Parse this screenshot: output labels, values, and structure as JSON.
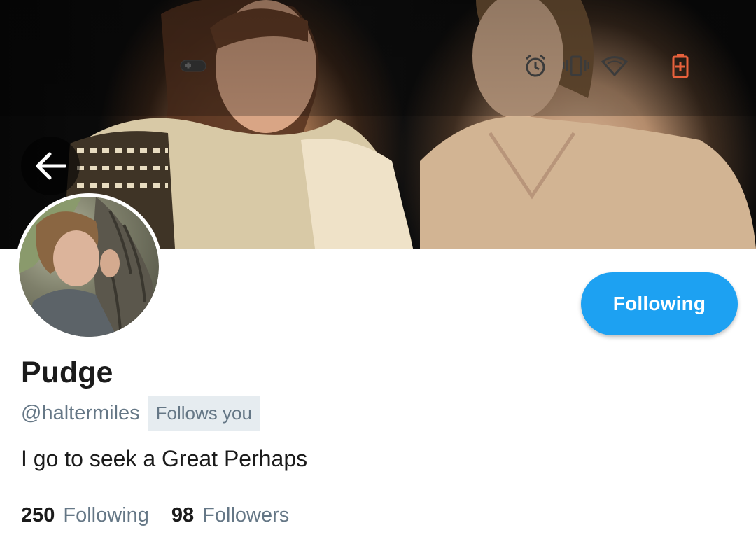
{
  "profile": {
    "display_name": "Pudge",
    "handle": "@haltermiles",
    "follows_you_badge": "Follows you",
    "bio": "I go to seek a Great Perhaps"
  },
  "actions": {
    "follow_button_label": "Following"
  },
  "stats": {
    "following_count": "250",
    "following_label": "Following",
    "followers_count": "98",
    "followers_label": "Followers"
  },
  "status_bar": {
    "icons": [
      "game-controller-icon",
      "alarm-icon",
      "vibrate-icon",
      "wifi-icon",
      "battery-charging-icon"
    ],
    "battery_color": "#e8613c"
  },
  "colors": {
    "accent": "#1da1f2",
    "secondary_text": "#657786",
    "badge_bg": "#e6ecf0",
    "primary_text": "#1b1b1b"
  }
}
